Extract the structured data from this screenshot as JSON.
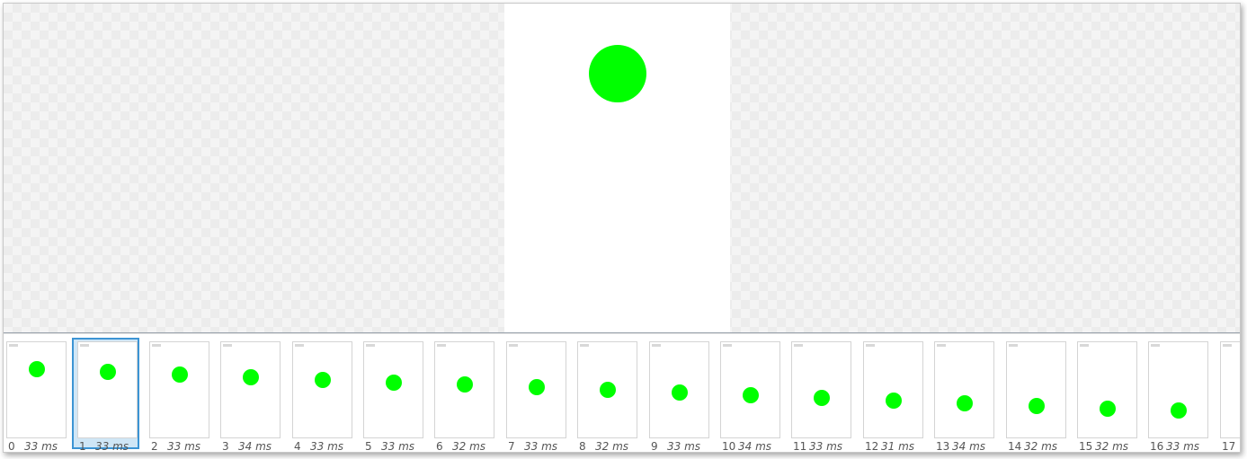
{
  "preview": {
    "ball_color": "#00ff00",
    "background": "#ffffff"
  },
  "filmstrip": {
    "selected_index": 1,
    "selection_color": "#3c94d4",
    "frames": [
      {
        "index": "0",
        "duration": "33 ms"
      },
      {
        "index": "1",
        "duration": "33 ms"
      },
      {
        "index": "2",
        "duration": "33 ms"
      },
      {
        "index": "3",
        "duration": "34 ms"
      },
      {
        "index": "4",
        "duration": "33 ms"
      },
      {
        "index": "5",
        "duration": "33 ms"
      },
      {
        "index": "6",
        "duration": "32 ms"
      },
      {
        "index": "7",
        "duration": "33 ms"
      },
      {
        "index": "8",
        "duration": "32 ms"
      },
      {
        "index": "9",
        "duration": "33 ms"
      },
      {
        "index": "10",
        "duration": "34 ms"
      },
      {
        "index": "11",
        "duration": "33 ms"
      },
      {
        "index": "12",
        "duration": "31 ms"
      },
      {
        "index": "13",
        "duration": "34 ms"
      },
      {
        "index": "14",
        "duration": "32 ms"
      },
      {
        "index": "15",
        "duration": "32 ms"
      },
      {
        "index": "16",
        "duration": "33 ms"
      },
      {
        "index": "17",
        "duration": ""
      }
    ]
  }
}
